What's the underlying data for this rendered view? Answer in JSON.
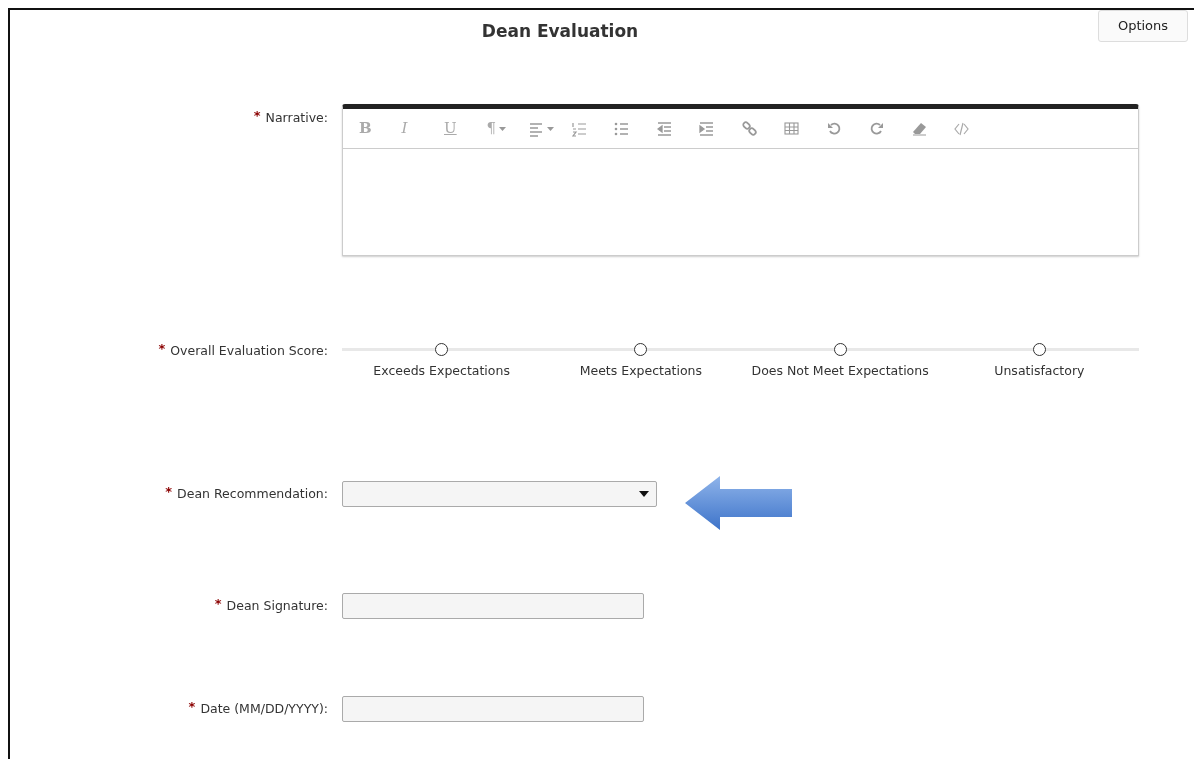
{
  "title": "Dean Evaluation",
  "options_button": "Options",
  "narrative": {
    "marker": "*",
    "label": "Narrative:",
    "toolbar": [
      {
        "kind": "glyph",
        "label": "B"
      },
      {
        "kind": "glyph",
        "label": "I"
      },
      {
        "kind": "glyph",
        "label": "U"
      },
      {
        "kind": "glyph",
        "label": "¶",
        "dropdown": true
      },
      {
        "kind": "icon",
        "dropdown": true
      },
      {
        "kind": "icon"
      },
      {
        "kind": "icon"
      },
      {
        "kind": "icon"
      },
      {
        "kind": "icon"
      },
      {
        "kind": "icon"
      },
      {
        "kind": "icon"
      },
      {
        "kind": "icon"
      },
      {
        "kind": "icon"
      },
      {
        "kind": "icon"
      },
      {
        "kind": "icon"
      }
    ]
  },
  "score": {
    "marker": "*",
    "label": "Overall Evaluation Score:",
    "options": [
      {
        "label": "Exceeds Expectations",
        "selected": false
      },
      {
        "label": "Meets Expectations",
        "selected": false
      },
      {
        "label": "Does Not Meet Expectations",
        "selected": false
      },
      {
        "label": "Unsatisfactory",
        "selected": false
      }
    ]
  },
  "recommendation": {
    "marker": "*",
    "label": "Dean Recommendation:"
  },
  "signature": {
    "marker": "*",
    "label": "Dean Signature:"
  },
  "date": {
    "marker": "*",
    "label": "Date (MM/DD/YYYY):"
  }
}
